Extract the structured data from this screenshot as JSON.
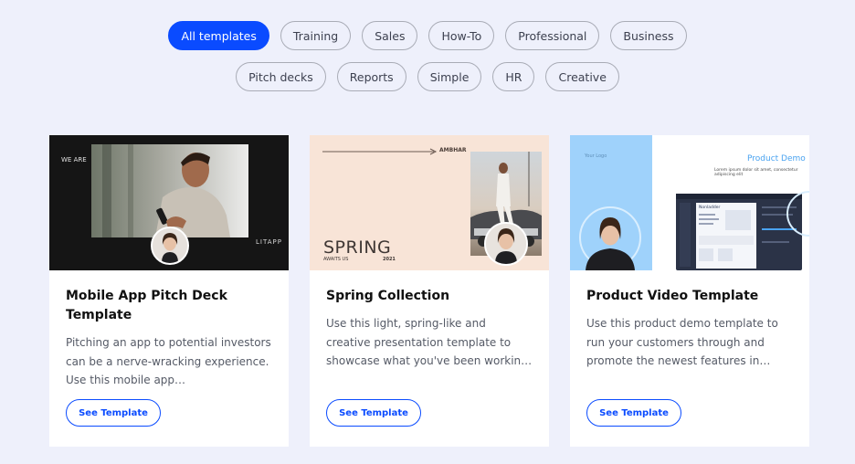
{
  "filters": {
    "row1": [
      "All templates",
      "Training",
      "Sales",
      "How-To",
      "Professional",
      "Business"
    ],
    "row2": [
      "Pitch decks",
      "Reports",
      "Simple",
      "HR",
      "Creative"
    ],
    "active": "All templates"
  },
  "cards": [
    {
      "title": "Mobile App Pitch Deck Template",
      "description": "Pitching an app to potential investors can be a nerve-wracking experience. Use this mobile app…",
      "button": "See Template",
      "thumb_text_1": "WE ARE",
      "thumb_text_2": "LITAPP"
    },
    {
      "title": "Spring Collection",
      "description": "Use this light, spring-like and creative presentation template to showcase what you've been workin…",
      "button": "See Template",
      "thumb_text_1": "AMBHAR",
      "thumb_text_2": "SPRING",
      "thumb_text_3": "AWAITS US",
      "thumb_text_4": "2021"
    },
    {
      "title": "Product Video Template",
      "description": "Use this product demo template to run your customers through and promote the newest features in you…",
      "button": "See Template",
      "thumb_text_1": "Your Logo",
      "thumb_text_2": "Product Demo",
      "thumb_text_3": "Lorem ipsum dolor sit amet, consectetur adipiscing elit",
      "thumb_text_4": "Nonladder"
    }
  ],
  "colors": {
    "background": "#eef0fb",
    "accent": "#0a4bff",
    "card": "#ffffff"
  }
}
